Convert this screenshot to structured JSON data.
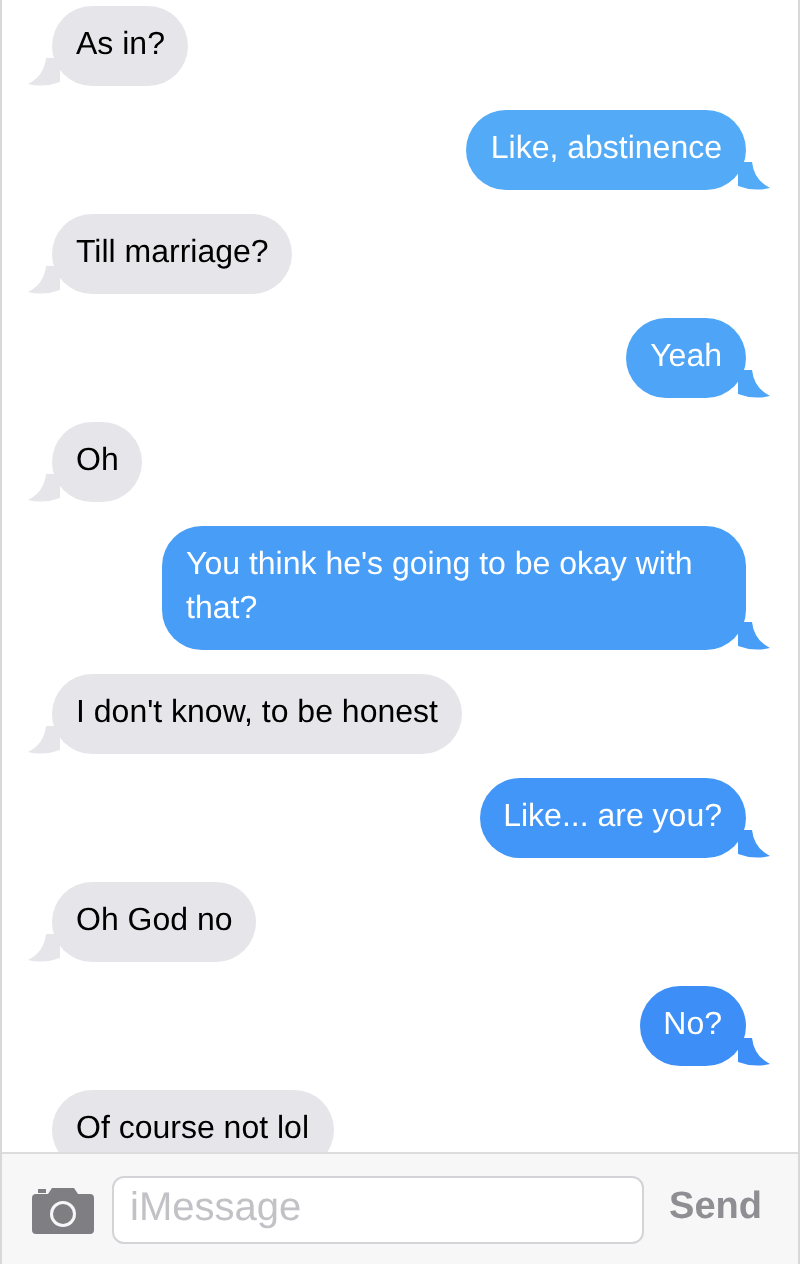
{
  "messages": [
    {
      "kind": "received",
      "text": "As in?"
    },
    {
      "kind": "sent",
      "text": "Like, abstinence"
    },
    {
      "kind": "received",
      "text": "Till marriage?"
    },
    {
      "kind": "sent",
      "text": "Yeah"
    },
    {
      "kind": "received",
      "text": "Oh"
    },
    {
      "kind": "sent",
      "text": "You think he's going to be okay with that?"
    },
    {
      "kind": "received",
      "text": "I don't know, to be honest"
    },
    {
      "kind": "sent",
      "text": "Like... are you?"
    },
    {
      "kind": "received",
      "text": "Oh God no"
    },
    {
      "kind": "sent",
      "text": "No?"
    },
    {
      "kind": "received",
      "text": "Of course not lol"
    }
  ],
  "composer": {
    "placeholder": "iMessage",
    "send": "Send"
  }
}
